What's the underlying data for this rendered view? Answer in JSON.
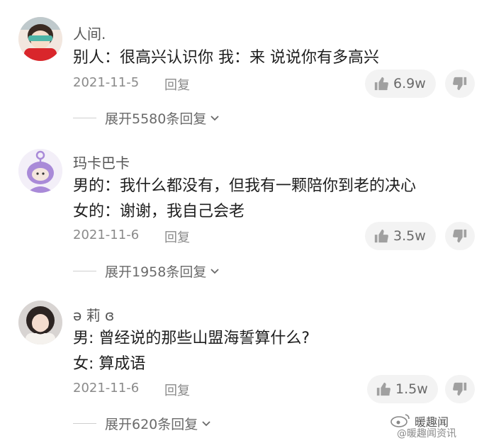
{
  "comments": [
    {
      "username": "人间.",
      "lines": [
        "别人：很高兴认识你 我：来 说说你有多高兴"
      ],
      "date": "2021-11-5",
      "reply_label": "回复",
      "likes": "6.9w",
      "expand_label": "展开5580条回复",
      "avatar_icon": "avatar-photo-girl-red"
    },
    {
      "username": "玛卡巴卡",
      "lines": [
        "男的：我什么都没有，但我有一颗陪你到老的决心",
        "女的：谢谢，我自己会老"
      ],
      "date": "2021-11-6",
      "reply_label": "回复",
      "likes": "3.5w",
      "expand_label": "展开1958条回复",
      "avatar_icon": "avatar-purple-teletubby"
    },
    {
      "username": "ə 莉 ɞ",
      "lines": [
        "男: 曾经说的那些山盟海誓算什么?",
        "女: 算成语"
      ],
      "date": "2021-11-6",
      "reply_label": "回复",
      "likes": "1.5w",
      "expand_label": "展开620条回复",
      "avatar_icon": "avatar-photo-girl"
    }
  ],
  "watermark": {
    "brand": "暖趣闻",
    "handle": "@暖趣闻资讯"
  },
  "colors": {
    "text": "#1e1e1e",
    "muted": "#8a8a8a",
    "pill_bg": "#f3f3f3",
    "avatar_purple": "#a98ad8"
  }
}
